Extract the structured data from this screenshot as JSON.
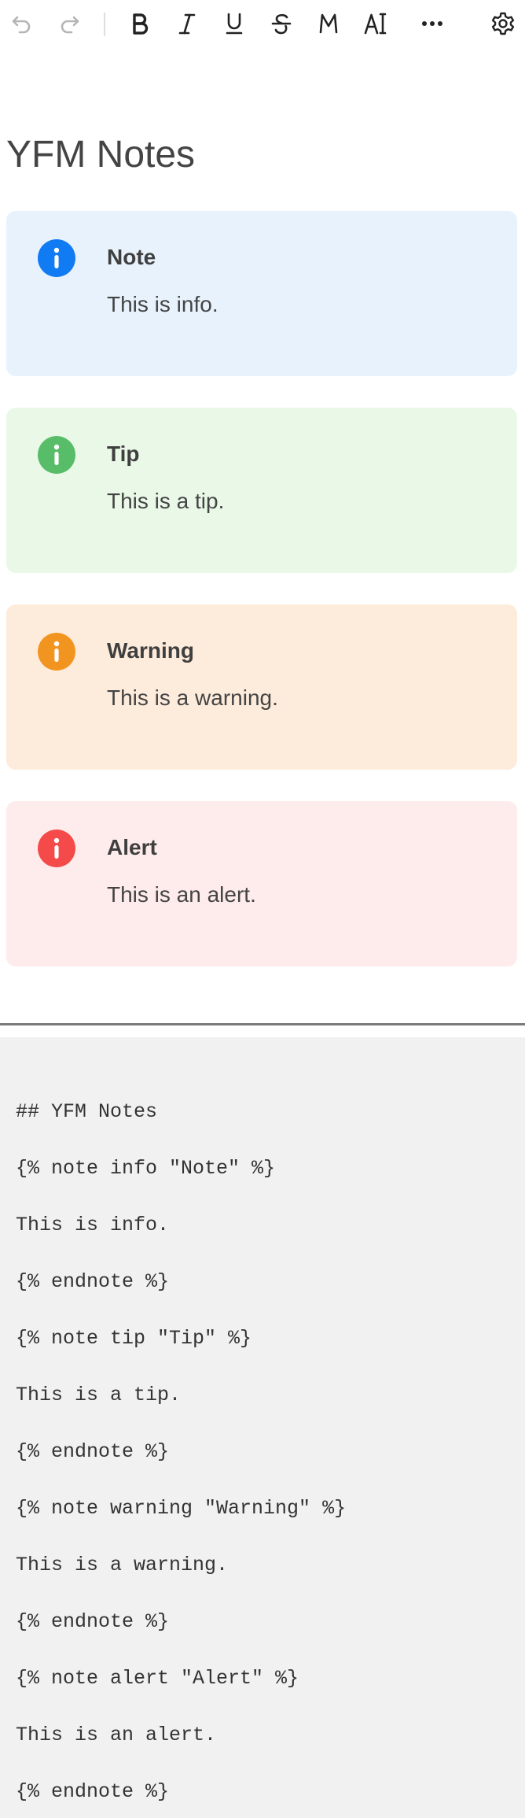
{
  "toolbar": {
    "buttons": [
      {
        "name": "undo",
        "icon": "undo-icon"
      },
      {
        "name": "redo",
        "icon": "redo-icon"
      },
      {
        "name": "bold",
        "icon": "bold-icon"
      },
      {
        "name": "italic",
        "icon": "italic-icon"
      },
      {
        "name": "underline",
        "icon": "underline-icon"
      },
      {
        "name": "strikethrough",
        "icon": "strikethrough-icon"
      },
      {
        "name": "monospace",
        "icon": "monospace-icon"
      },
      {
        "name": "text-style",
        "icon": "text-style-icon"
      },
      {
        "name": "more",
        "icon": "more-icon"
      },
      {
        "name": "settings",
        "icon": "gear-icon"
      }
    ]
  },
  "document": {
    "title": "YFM Notes",
    "notes": [
      {
        "type": "info",
        "title": "Note",
        "body": "This is info.",
        "bg": "#e8f2fd",
        "icon_color": "#117bf3"
      },
      {
        "type": "tip",
        "title": "Tip",
        "body": "This is a tip.",
        "bg": "#eaf8e8",
        "icon_color": "#57bd68"
      },
      {
        "type": "warning",
        "title": "Warning",
        "body": "This is a warning.",
        "bg": "#fdecdc",
        "icon_color": "#f29520"
      },
      {
        "type": "alert",
        "title": "Alert",
        "body": "This is an alert.",
        "bg": "#fdeceb",
        "icon_color": "#f44a4a"
      }
    ]
  },
  "markdown_source": {
    "lines": [
      "## YFM Notes",
      "{% note info \"Note\" %}",
      "This is info.",
      "{% endnote %}",
      "{% note tip \"Tip\" %}",
      "This is a tip.",
      "{% endnote %}",
      "{% note warning \"Warning\" %}",
      "This is a warning.",
      "{% endnote %}",
      "{% note alert \"Alert\" %}",
      "This is an alert.",
      "{% endnote %}"
    ]
  }
}
